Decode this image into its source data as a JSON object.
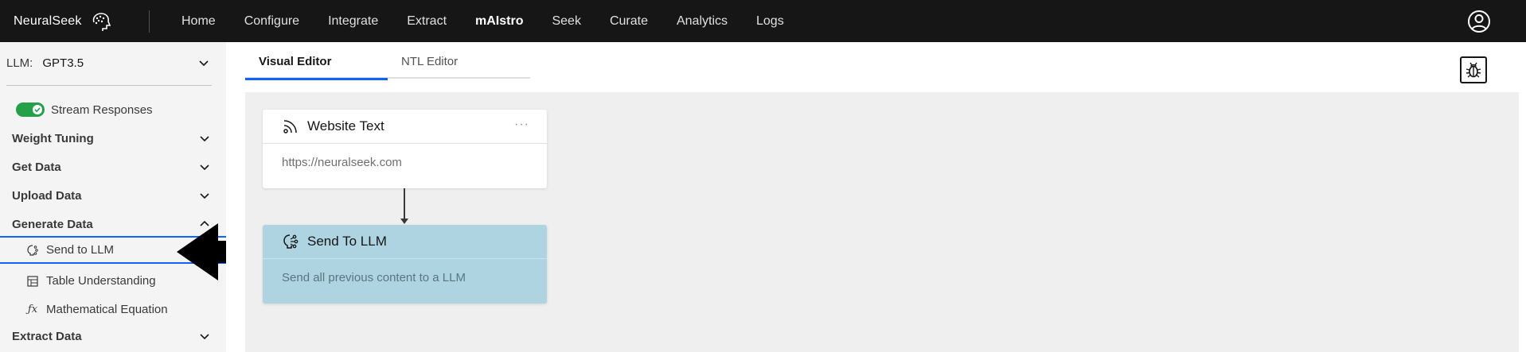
{
  "brand": {
    "name": "NeuralSeek",
    "logo_icon": "brain-icon"
  },
  "nav": {
    "items": [
      {
        "label": "Home",
        "bold": false
      },
      {
        "label": "Configure",
        "bold": false
      },
      {
        "label": "Integrate",
        "bold": false
      },
      {
        "label": "Extract",
        "bold": false
      },
      {
        "label": "mAIstro",
        "bold": true
      },
      {
        "label": "Seek",
        "bold": false
      },
      {
        "label": "Curate",
        "bold": false
      },
      {
        "label": "Analytics",
        "bold": false
      },
      {
        "label": "Logs",
        "bold": false
      }
    ],
    "user_icon": "user-avatar-icon"
  },
  "sidebar": {
    "llm_label": "LLM:",
    "llm_value": "GPT3.5",
    "stream_label": "Stream Responses",
    "stream_enabled": true,
    "sections": [
      {
        "label": "Weight Tuning",
        "expanded": false
      },
      {
        "label": "Get Data",
        "expanded": false
      },
      {
        "label": "Upload Data",
        "expanded": false
      },
      {
        "label": "Generate Data",
        "expanded": true
      },
      {
        "label": "Extract Data",
        "expanded": false
      }
    ],
    "generate_items": [
      {
        "label": "Send to LLM",
        "icon": "ai-brain-icon",
        "selected": true
      },
      {
        "label": "Table Understanding",
        "icon": "table-icon",
        "selected": false
      },
      {
        "label": "Mathematical Equation",
        "icon": "function-icon",
        "selected": false
      }
    ]
  },
  "editor": {
    "tabs": [
      {
        "label": "Visual Editor",
        "active": true
      },
      {
        "label": "NTL Editor",
        "active": false
      }
    ],
    "debug_icon": "bug-icon",
    "nodes": [
      {
        "title": "Website Text",
        "body": "https://neuralseek.com",
        "icon": "rss-feed-icon",
        "menu": "···"
      },
      {
        "title": "Send To LLM",
        "body": "Send all previous content to a LLM",
        "icon": "ai-brain-icon"
      }
    ]
  },
  "colors": {
    "accent": "#0f62fe",
    "toggle_on": "#24a148",
    "llm_node": "#add4e0",
    "topbar": "#161616"
  }
}
